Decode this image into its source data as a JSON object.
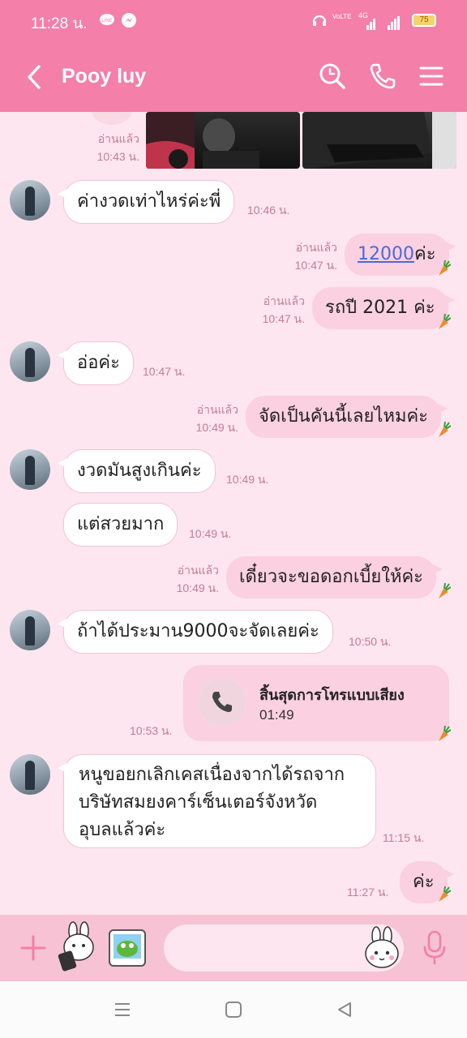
{
  "status": {
    "time": "11:28 น.",
    "battery": "75",
    "vo_label": "VoLTE",
    "net_label": "4G"
  },
  "header": {
    "title": "Pooy luy"
  },
  "messages": {
    "m0": {
      "read": "อ่านแล้ว",
      "time": "10:43 น."
    },
    "m1": {
      "text": "ค่างวดเท่าไหร่ค่ะพี่",
      "time": "10:46 น."
    },
    "m2": {
      "text": "12000",
      "suffix": "ค่ะ",
      "read": "อ่านแล้ว",
      "time": "10:47 น."
    },
    "m3": {
      "text": "รถปี 2021 ค่ะ",
      "read": "อ่านแล้ว",
      "time": "10:47 น."
    },
    "m4": {
      "text": "อ่อค่ะ",
      "time": "10:47 น."
    },
    "m5": {
      "text": "จัดเป็นคันนี้เลยไหมค่ะ",
      "read": "อ่านแล้ว",
      "time": "10:49 น."
    },
    "m6": {
      "text": "งวดมันสูงเกินค่ะ",
      "time": "10:49 น."
    },
    "m7": {
      "text": "แต่สวยมาก",
      "time": "10:49 น."
    },
    "m8": {
      "text": "เดี๋ยวจะขอดอกเบี้ยให้ค่ะ",
      "read": "อ่านแล้ว",
      "time": "10:49 น."
    },
    "m9": {
      "text": "ถ้าได้ประมาน9000จะจัดเลยค่ะ",
      "time": "10:50 น."
    },
    "call": {
      "title": "สิ้นสุดการโทรแบบเสียง",
      "duration": "01:49",
      "time": "10:53 น."
    },
    "m10": {
      "line1": "หนูขอยกเลิกเคสเนื่องจากได้รถจาก",
      "line2": "บริษัทสมยงคาร์เซ็นเตอร์จังหวัด",
      "line3": "อุบลแล้วค่ะ",
      "time": "11:15 น."
    },
    "m11": {
      "text": "ค่ะ",
      "time": "11:27 น."
    }
  },
  "colors": {
    "header": "#f47fa8",
    "chat_bg": "#fde6ef",
    "bubble_out": "#fbd0e0",
    "input_bar": "#f7c2d4"
  },
  "icons": [
    "back-icon",
    "search-icon",
    "phone-icon",
    "menu-icon",
    "plus-icon",
    "sticker-icon",
    "photo-icon",
    "emoji-icon",
    "mic-icon",
    "carrot-icon"
  ]
}
